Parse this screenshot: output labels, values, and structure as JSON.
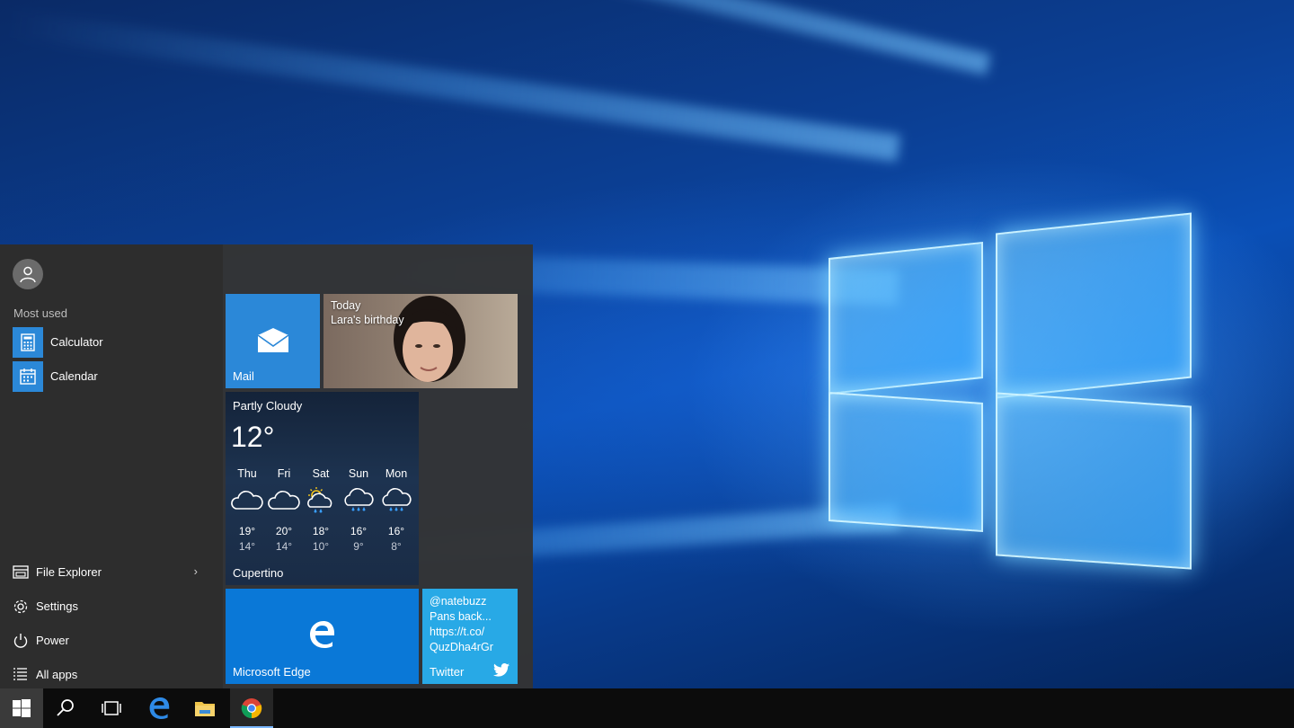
{
  "start_menu": {
    "user": {
      "icon": "user-icon"
    },
    "most_used_label": "Most used",
    "apps": [
      {
        "label": "Calculator",
        "icon": "calculator-icon"
      },
      {
        "label": "Calendar",
        "icon": "calendar-icon"
      }
    ],
    "system": [
      {
        "label": "File Explorer",
        "icon": "file-explorer-icon",
        "chevron": "›"
      },
      {
        "label": "Settings",
        "icon": "gear-icon"
      },
      {
        "label": "Power",
        "icon": "power-icon"
      },
      {
        "label": "All apps",
        "icon": "list-icon"
      }
    ]
  },
  "tiles": {
    "mail": {
      "label": "Mail",
      "icon": "mail-icon"
    },
    "photo": {
      "line1": "Today",
      "line2": "Lara's birthday"
    },
    "weather": {
      "condition": "Partly Cloudy",
      "temp": "12°",
      "city": "Cupertino",
      "forecast": [
        {
          "day": "Thu",
          "hi": "19°",
          "lo": "14°",
          "icon": "cloudy-icon"
        },
        {
          "day": "Fri",
          "hi": "20°",
          "lo": "14°",
          "icon": "cloudy-icon"
        },
        {
          "day": "Sat",
          "hi": "18°",
          "lo": "10°",
          "icon": "sun-rain-icon"
        },
        {
          "day": "Sun",
          "hi": "16°",
          "lo": "9°",
          "icon": "rain-icon"
        },
        {
          "day": "Mon",
          "hi": "16°",
          "lo": "8°",
          "icon": "rain-icon"
        }
      ]
    },
    "edge": {
      "label": "Microsoft Edge",
      "icon": "edge-icon"
    },
    "twitter": {
      "label": "Twitter",
      "lines": [
        "@natebuzz",
        "Pans back...",
        "https://t.co/",
        "QuzDha4rGr"
      ],
      "icon": "twitter-bird-icon"
    }
  },
  "taskbar": {
    "buttons": [
      "start-button",
      "search-button",
      "task-view-button",
      "edge-button",
      "file-explorer-button",
      "chrome-button"
    ]
  },
  "colors": {
    "accent": "#2b88d8",
    "edge_tile": "#0a78d7",
    "twitter_tile": "#28a9e6",
    "taskbar": "#0c0c0c"
  }
}
